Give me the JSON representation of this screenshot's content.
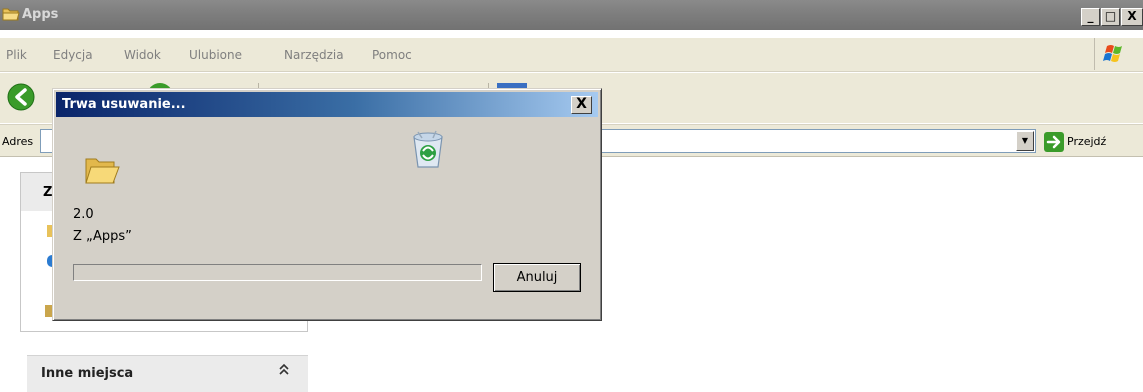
{
  "window": {
    "title": "Apps",
    "buttons": {
      "minimize": "_",
      "maximize": "□",
      "close": "X"
    }
  },
  "menu": [
    "Plik",
    "Edycja",
    "Widok",
    "Ulubione",
    "Narzędzia",
    "Pomoc"
  ],
  "address": {
    "label": "Adres",
    "go_label": "Przejdź"
  },
  "left_pane": {
    "box1_heading_letter": "Z",
    "other_places_title": "Inne miejsca"
  },
  "dialog": {
    "title": "Trwa usuwanie...",
    "close": "X",
    "item_name": "2.0",
    "from_text": "Z „Apps”",
    "progress": 0,
    "cancel_label": "Anuluj"
  },
  "icons": {
    "title": "folder-icon",
    "back": "back-arrow-icon",
    "go": "go-arrow-icon",
    "dialog_folder": "folder-open-icon",
    "dialog_bin": "recycle-bin-icon",
    "windows_logo": "windows-logo-icon"
  },
  "colors": {
    "dialog_title_start": "#0a246a",
    "dialog_title_end": "#a6caf0",
    "inactive_title": "#7e7e7e",
    "face": "#d4d0c8"
  }
}
